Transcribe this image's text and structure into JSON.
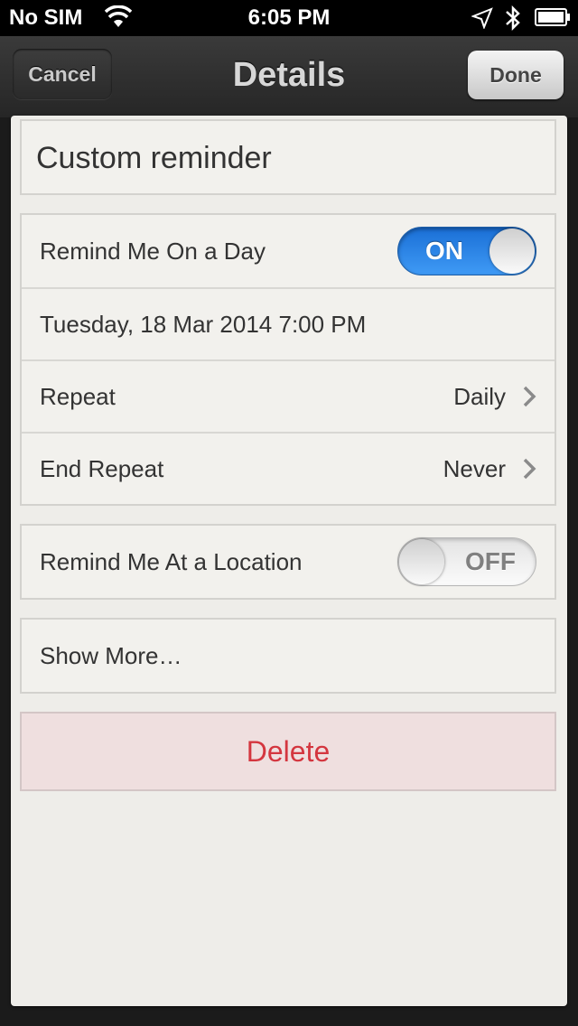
{
  "status_bar": {
    "carrier": "No SIM",
    "time": "6:05 PM",
    "icons": [
      "wifi-icon",
      "location-arrow-icon",
      "bluetooth-icon",
      "battery-icon"
    ]
  },
  "nav": {
    "title": "Details",
    "cancel_label": "Cancel",
    "done_label": "Done"
  },
  "reminder": {
    "title": "Custom reminder"
  },
  "day_section": {
    "remind_day_label": "Remind Me On a Day",
    "remind_day_toggle": "ON",
    "date_text": "Tuesday, 18 Mar 2014 7:00 PM",
    "repeat_label": "Repeat",
    "repeat_value": "Daily",
    "end_repeat_label": "End Repeat",
    "end_repeat_value": "Never"
  },
  "location_section": {
    "remind_location_label": "Remind Me At a Location",
    "remind_location_toggle": "OFF"
  },
  "more": {
    "label": "Show More…"
  },
  "delete": {
    "label": "Delete"
  },
  "colors": {
    "toggle_on": "#2a86ea",
    "delete_text": "#d4363f",
    "delete_bg": "#efdfdf",
    "paper": "#eeede9"
  }
}
